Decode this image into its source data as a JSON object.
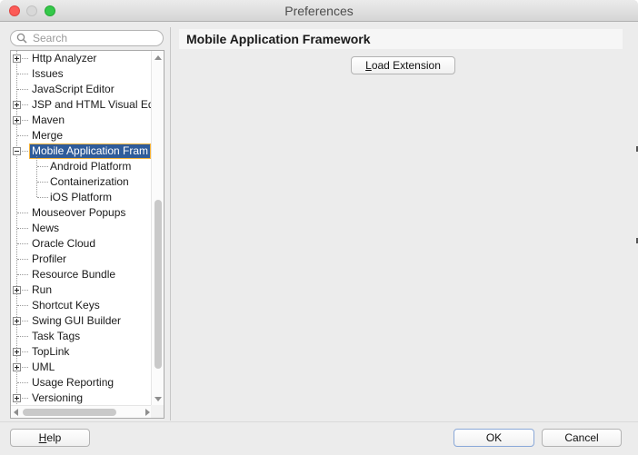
{
  "window": {
    "title": "Preferences"
  },
  "search": {
    "placeholder": "Search",
    "value": ""
  },
  "tree": {
    "items": [
      {
        "label": "Http Analyzer",
        "expandable": true,
        "level": 0
      },
      {
        "label": "Issues",
        "expandable": false,
        "level": 0
      },
      {
        "label": "JavaScript Editor",
        "expandable": false,
        "level": 0
      },
      {
        "label": "JSP and HTML Visual Edit",
        "expandable": true,
        "level": 0
      },
      {
        "label": "Maven",
        "expandable": true,
        "level": 0
      },
      {
        "label": "Merge",
        "expandable": false,
        "level": 0
      },
      {
        "label": "Mobile Application Fram",
        "expandable": true,
        "expanded": true,
        "selected": true,
        "level": 0
      },
      {
        "label": "Android Platform",
        "expandable": false,
        "level": 1
      },
      {
        "label": "Containerization",
        "expandable": false,
        "level": 1
      },
      {
        "label": "iOS Platform",
        "expandable": false,
        "level": 1
      },
      {
        "label": "Mouseover Popups",
        "expandable": false,
        "level": 0
      },
      {
        "label": "News",
        "expandable": false,
        "level": 0
      },
      {
        "label": "Oracle Cloud",
        "expandable": false,
        "level": 0
      },
      {
        "label": "Profiler",
        "expandable": false,
        "level": 0
      },
      {
        "label": "Resource Bundle",
        "expandable": false,
        "level": 0
      },
      {
        "label": "Run",
        "expandable": true,
        "level": 0
      },
      {
        "label": "Shortcut Keys",
        "expandable": false,
        "level": 0
      },
      {
        "label": "Swing GUI Builder",
        "expandable": true,
        "level": 0
      },
      {
        "label": "Task Tags",
        "expandable": false,
        "level": 0
      },
      {
        "label": "TopLink",
        "expandable": true,
        "level": 0
      },
      {
        "label": "UML",
        "expandable": true,
        "level": 0
      },
      {
        "label": "Usage Reporting",
        "expandable": false,
        "level": 0
      },
      {
        "label": "Versioning",
        "expandable": true,
        "level": 0
      }
    ]
  },
  "content": {
    "header": "Mobile Application Framework",
    "load_extension_label": "Load Extension"
  },
  "buttons": {
    "help": "Help",
    "ok": "OK",
    "cancel": "Cancel"
  }
}
